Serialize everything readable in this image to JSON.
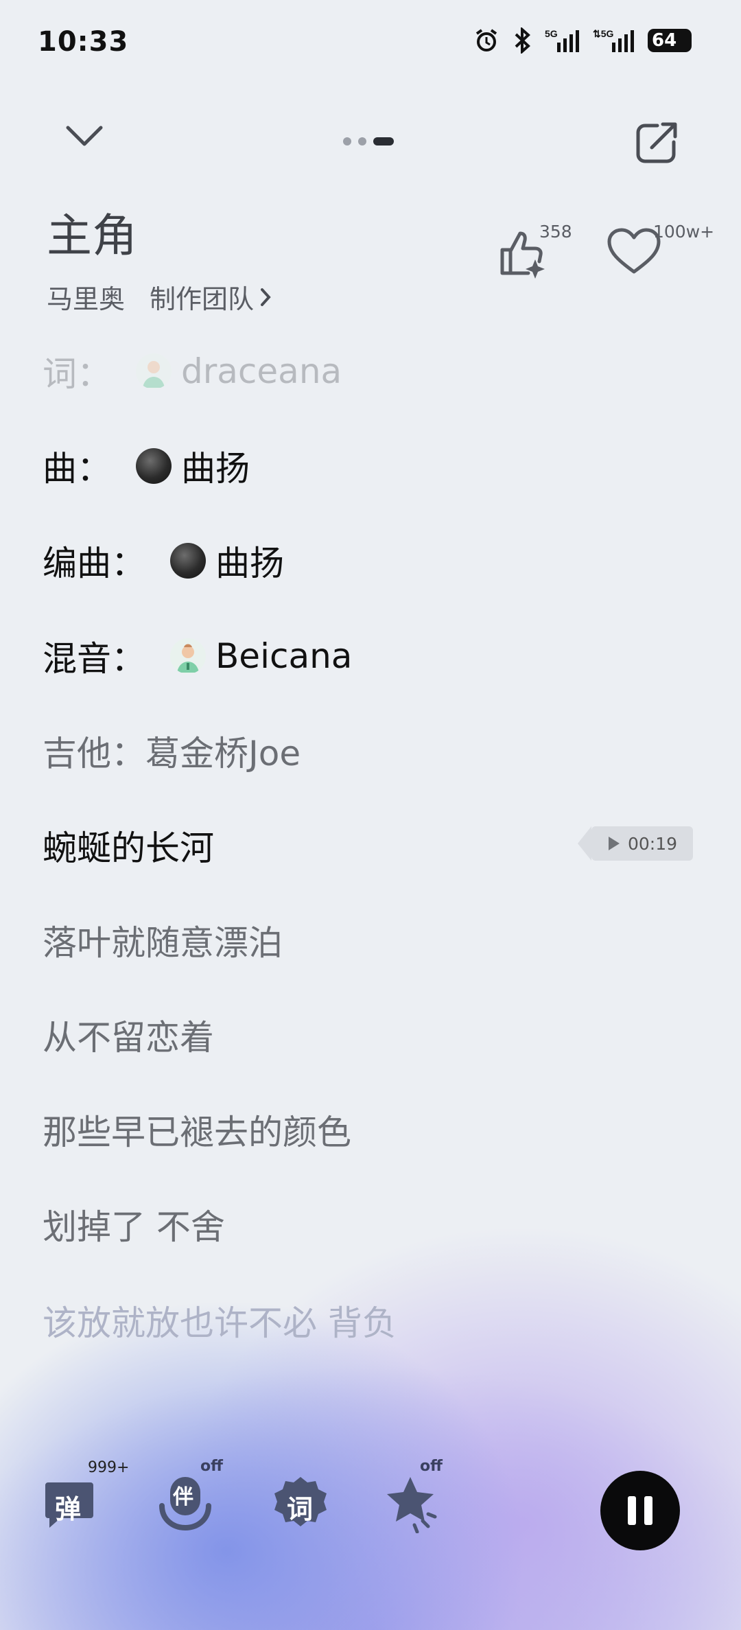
{
  "status_bar": {
    "time": "10:33",
    "battery": "64"
  },
  "song": {
    "title": "主角",
    "artist": "马里奥",
    "credits_link": "制作团队"
  },
  "stats": {
    "likes": "358",
    "favorites": "100w+"
  },
  "credits": [
    {
      "role": "词：",
      "name": "draceana"
    },
    {
      "role": "曲：",
      "name": "曲扬"
    },
    {
      "role": "编曲：",
      "name": "曲扬"
    },
    {
      "role": "混音：",
      "name": "Beicana"
    },
    {
      "role": "吉他：",
      "name": "葛金桥Joe"
    }
  ],
  "lyrics": [
    "蜿蜒的长河",
    "落叶就随意漂泊",
    "从不留恋着",
    "那些早已褪去的颜色",
    "划掉了 不舍",
    "该放就放也许不必 背负"
  ],
  "preview": {
    "time": "00:19"
  },
  "toolbar": {
    "danmaku_label": "弹",
    "danmaku_count": "999+",
    "accompany_label": "伴",
    "accompany_state": "off",
    "lyrics_label": "词",
    "effect_state": "off"
  },
  "colors": {
    "accent_dark": "#0a0a0b",
    "toolbar_icon": "#4b5472"
  }
}
